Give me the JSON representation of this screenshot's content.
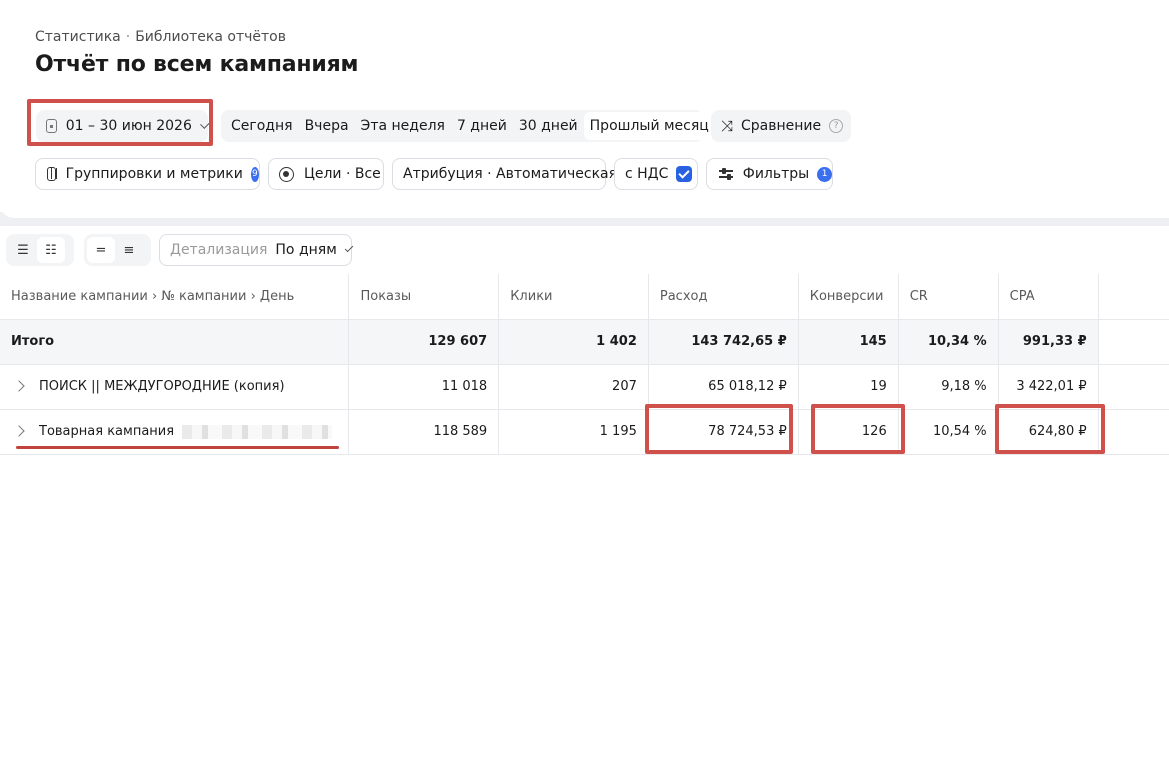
{
  "breadcrumb": {
    "root": "Статистика",
    "separator": "·",
    "current": "Библиотека отчётов"
  },
  "page_title": "Отчёт по всем кампаниям",
  "date_range": {
    "value": "01 – 30 июн 2026"
  },
  "periods": [
    "Сегодня",
    "Вчера",
    "Эта неделя",
    "7 дней",
    "30 дней"
  ],
  "period_selected": "Прошлый месяц",
  "compare": {
    "label": "Сравнение",
    "help": "?"
  },
  "settings": {
    "groupings_label": "Группировки и метрики",
    "groupings_count": "9",
    "goals_label": "Цели · Все",
    "attribution_label": "Атрибуция · Автоматическая",
    "vat_label": "с НДС",
    "vat_checked": true,
    "filters_label": "Фильтры",
    "filters_count": "1"
  },
  "toolbar": {
    "detail_label": "Детализация",
    "detail_value": "По дням"
  },
  "table": {
    "headers": [
      "Название кампании › № кампании › День",
      "Показы",
      "Клики",
      "Расход",
      "Конверсии",
      "CR",
      "CPA"
    ],
    "total": {
      "name": "Итого",
      "shows": "129 607",
      "clicks": "1 402",
      "spend": "143 742,65 ₽",
      "conversions": "145",
      "cr": "10,34 %",
      "cpa": "991,33 ₽"
    },
    "rows": [
      {
        "name": "ПОИСК || МЕЖДУГОРОДНИЕ (копия)",
        "shows": "11 018",
        "clicks": "207",
        "spend": "65 018,12 ₽",
        "conversions": "19",
        "cr": "9,18 %",
        "cpa": "3 422,01 ₽"
      },
      {
        "name": "Товарная кампания",
        "shows": "118 589",
        "clicks": "1 195",
        "spend": "78 724,53 ₽",
        "conversions": "126",
        "cr": "10,54 %",
        "cpa": "624,80 ₽"
      }
    ]
  },
  "colors": {
    "accent": "#2962e0",
    "highlight": "#d0514c",
    "badge": "#3a6ff0"
  }
}
